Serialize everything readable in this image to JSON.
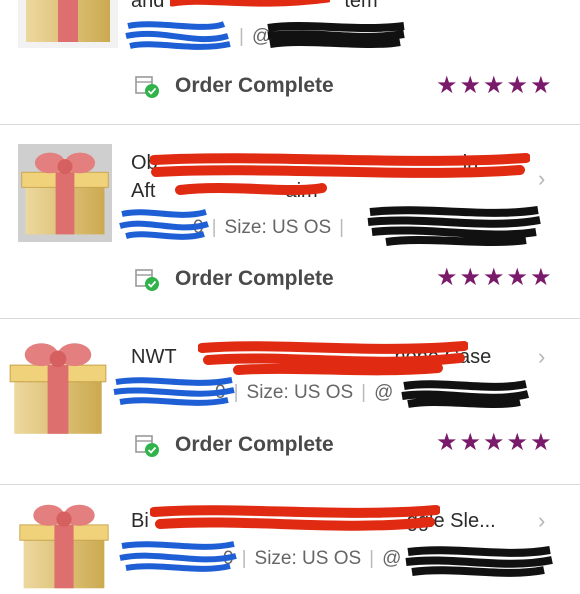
{
  "orders": [
    {
      "title_visible": "and",
      "title_tail": "tem",
      "meta_visible": "@",
      "status": "Order Complete",
      "rating": 5,
      "icons": {
        "product": "gift-box-icon",
        "status": "package-check-icon",
        "chevron": "chevron-right-icon"
      }
    },
    {
      "title_line1": "Ob",
      "title_line1_tail": "in",
      "title_line2": "Aft",
      "title_line2_tail": "aim",
      "meta_prefix": "0",
      "size_label": "Size: US OS",
      "status": "Order Complete",
      "rating": 5
    },
    {
      "title_line1": "NWT",
      "title_tail": "hone Case",
      "meta_prefix": "0",
      "size_label": "Size: US OS",
      "meta_suffix": "@",
      "status": "Order Complete",
      "rating": 5
    },
    {
      "title_line1": "Bi",
      "title_tail": "ggle Sle...",
      "meta_prefix": "0",
      "size_label": "Size: US OS",
      "meta_suffix": "@",
      "status": "Order Complete",
      "rating": 5
    }
  ],
  "colors": {
    "star": "#7a1a6a",
    "check": "#2fb34a",
    "redaction_red": "#e02a12",
    "redaction_blue": "#1f5fd6",
    "redaction_black": "#111111"
  }
}
